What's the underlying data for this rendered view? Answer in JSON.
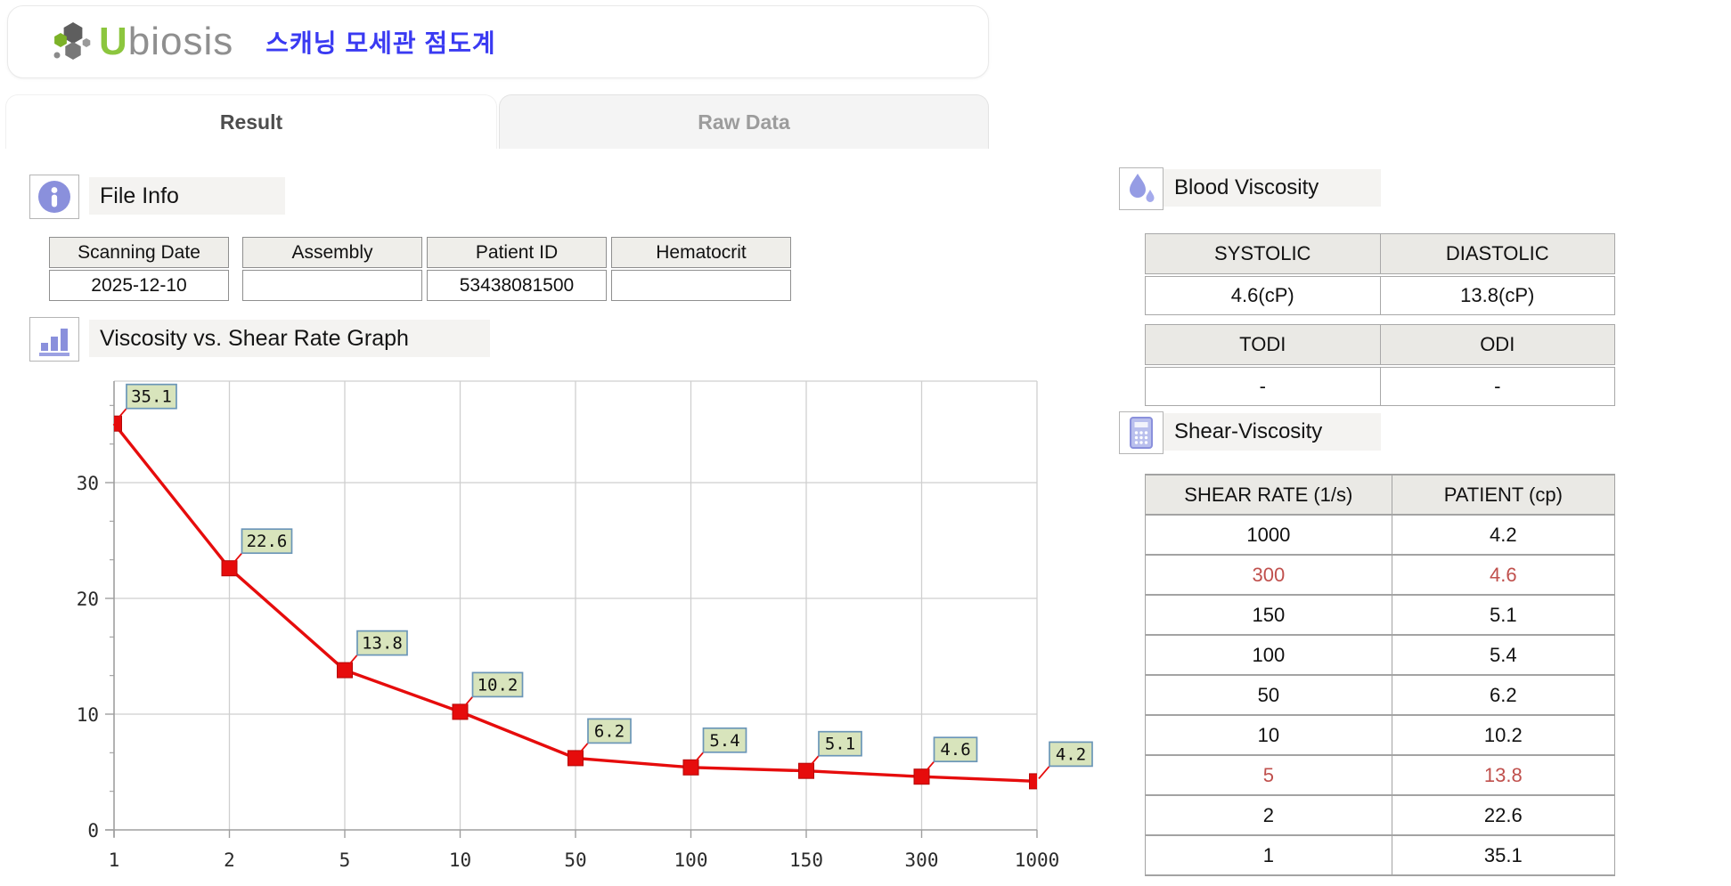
{
  "header": {
    "brand_first_letter": "U",
    "brand_rest": "biosis",
    "app_title": "스캐닝 모세관 점도계"
  },
  "tabs": [
    {
      "label": "Result",
      "active": true
    },
    {
      "label": "Raw Data",
      "active": false
    }
  ],
  "file_info": {
    "section_title": "File Info",
    "fields": [
      {
        "label": "Scanning Date",
        "value": "2025-12-10"
      },
      {
        "label": "Assembly",
        "value": ""
      },
      {
        "label": "Patient ID",
        "value": "53438081500"
      },
      {
        "label": "Hematocrit",
        "value": ""
      }
    ]
  },
  "graph_section": {
    "section_title": "Viscosity vs. Shear Rate Graph"
  },
  "chart_data": {
    "type": "line",
    "title": "Viscosity vs. Shear Rate Graph",
    "xlabel": "",
    "ylabel": "",
    "x_categories": [
      "1",
      "2",
      "5",
      "10",
      "50",
      "100",
      "150",
      "300",
      "1000"
    ],
    "values": [
      35.1,
      22.6,
      13.8,
      10.2,
      6.2,
      5.4,
      5.1,
      4.6,
      4.2
    ],
    "y_ticks": [
      0,
      10,
      20,
      30
    ],
    "ylim": [
      0,
      38.8
    ],
    "grid": true,
    "legend": "none",
    "colors": {
      "series": "#e60c0c",
      "marker": "#e60c0c",
      "grid": "#cfcfcf",
      "axis": "#9f9f9f",
      "label_fill": "#d8e4bc",
      "label_border": "#6b96b8"
    }
  },
  "blood_viscosity": {
    "section_title": "Blood Viscosity",
    "table1": {
      "headers": [
        "SYSTOLIC",
        "DIASTOLIC"
      ],
      "values": [
        "4.6(cP)",
        "13.8(cP)"
      ]
    },
    "table2": {
      "headers": [
        "TODI",
        "ODI"
      ],
      "values": [
        "-",
        "-"
      ]
    }
  },
  "shear_viscosity": {
    "section_title": "Shear-Viscosity",
    "headers": [
      "SHEAR RATE (1/s)",
      "PATIENT (cp)"
    ],
    "rows": [
      {
        "shear_rate": "1000",
        "patient": "4.2",
        "highlight": false
      },
      {
        "shear_rate": "300",
        "patient": "4.6",
        "highlight": true
      },
      {
        "shear_rate": "150",
        "patient": "5.1",
        "highlight": false
      },
      {
        "shear_rate": "100",
        "patient": "5.4",
        "highlight": false
      },
      {
        "shear_rate": "50",
        "patient": "6.2",
        "highlight": false
      },
      {
        "shear_rate": "10",
        "patient": "10.2",
        "highlight": false
      },
      {
        "shear_rate": "5",
        "patient": "13.8",
        "highlight": true
      },
      {
        "shear_rate": "2",
        "patient": "22.6",
        "highlight": false
      },
      {
        "shear_rate": "1",
        "patient": "35.1",
        "highlight": false
      }
    ]
  },
  "colors": {
    "accent_blue": "#3a3af2",
    "brand_green": "#8cc63e",
    "brand_gray": "#8f8f8f",
    "icon_purple": "#8a90dc",
    "highlight_red": "#c0504d"
  },
  "icons": [
    "ubiosis-logo-icon",
    "info-icon",
    "bar-chart-icon",
    "blood-drops-icon",
    "calculator-icon"
  ]
}
